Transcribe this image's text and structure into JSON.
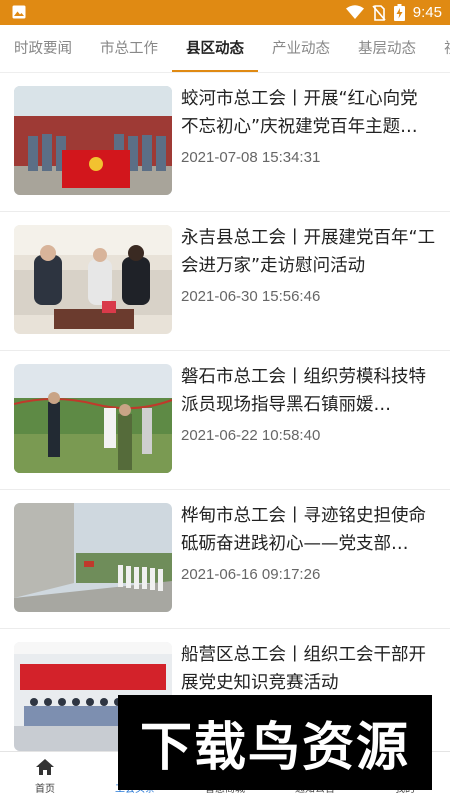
{
  "status_bar": {
    "time": "9:45",
    "icons": [
      "image-icon",
      "wifi-icon",
      "no-sim-icon",
      "battery-charging-icon"
    ]
  },
  "tabs": [
    {
      "label": "时政要闻",
      "active": false
    },
    {
      "label": "市总工作",
      "active": false
    },
    {
      "label": "县区动态",
      "active": true
    },
    {
      "label": "产业动态",
      "active": false
    },
    {
      "label": "基层动态",
      "active": false
    },
    {
      "label": "视",
      "active": false
    }
  ],
  "news": [
    {
      "title": "蛟河市总工会丨开展“红心向党 不忘初心”庆祝建党百年主题…",
      "date": "2021-07-08 15:34:31"
    },
    {
      "title": "永吉县总工会丨开展建党百年“工会进万家”走访慰问活动",
      "date": "2021-06-30 15:56:46"
    },
    {
      "title": "磐石市总工会丨组织劳模科技特派员现场指导黑石镇丽媛…",
      "date": "2021-06-22 10:58:40"
    },
    {
      "title": "桦甸市总工会丨寻迹铭史担使命 砥砺奋进践初心——党支部…",
      "date": "2021-06-16 09:17:26"
    },
    {
      "title": "船营区总工会丨组织工会干部开展党史知识竞赛活动",
      "date": ""
    }
  ],
  "bottom_nav": [
    {
      "label": "首页",
      "icon": "home-icon",
      "active": false
    },
    {
      "label": "工会头条",
      "icon": "news-icon",
      "active": true
    },
    {
      "label": "普惠商城",
      "icon": "shop-icon",
      "active": false
    },
    {
      "label": "通知公告",
      "icon": "notice-icon",
      "active": false
    },
    {
      "label": "我的",
      "icon": "profile-icon",
      "active": false
    }
  ],
  "watermark": "下载鸟资源",
  "colors": {
    "accent": "#e08a13",
    "active_nav": "#2a7ad6"
  }
}
